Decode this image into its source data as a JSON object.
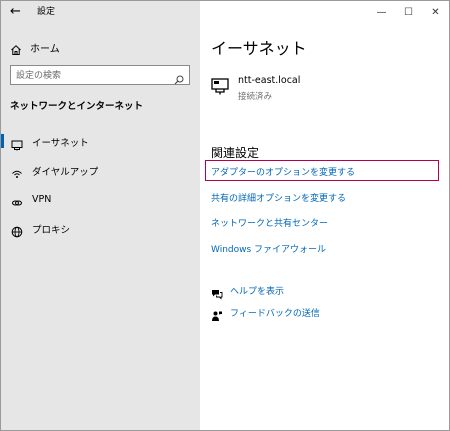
{
  "sidebar": {
    "app_title": "設定",
    "home_label": "ホーム",
    "search_placeholder": "設定の検索",
    "section_title": "ネットワークとインターネット",
    "items": [
      {
        "label": "イーサネット",
        "icon": "ethernet-icon",
        "active": true
      },
      {
        "label": "ダイヤルアップ",
        "icon": "dialup-icon",
        "active": false
      },
      {
        "label": "VPN",
        "icon": "vpn-icon",
        "active": false
      },
      {
        "label": "プロキシ",
        "icon": "globe-icon",
        "active": false
      }
    ]
  },
  "main": {
    "page_title": "イーサネット",
    "network": {
      "name": "ntt-east.local",
      "status": "接続済み"
    },
    "related_title": "関連設定",
    "links": [
      "アダプターのオプションを変更する",
      "共有の詳細オプションを変更する",
      "ネットワークと共有センター",
      "Windows ファイアウォール"
    ],
    "help": [
      {
        "label": "ヘルプを表示",
        "icon": "help-chat-icon"
      },
      {
        "label": "フィードバックの送信",
        "icon": "feedback-icon"
      }
    ]
  },
  "colors": {
    "accent": "#0067b8",
    "focus_outline": "#b5004f",
    "sidebar_bg": "#e6e6e6"
  }
}
